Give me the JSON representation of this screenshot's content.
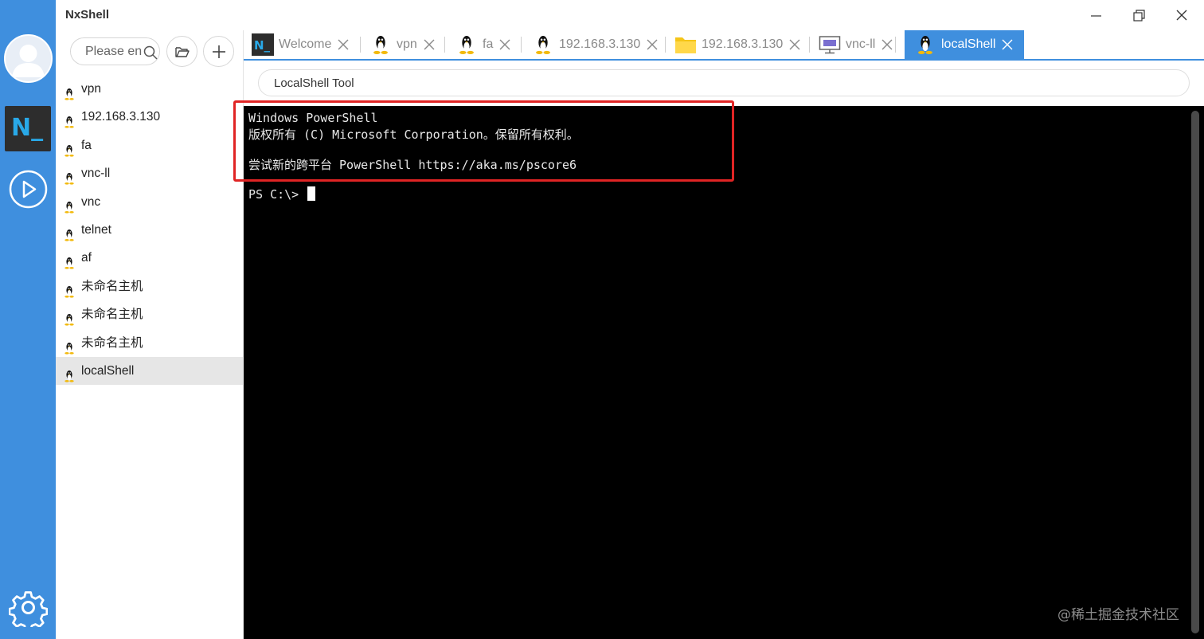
{
  "app": {
    "title": "NxShell"
  },
  "rail": {
    "logo_text": "N_"
  },
  "sidebar": {
    "search_placeholder": "Please en",
    "hosts": [
      {
        "label": "vpn"
      },
      {
        "label": "192.168.3.130"
      },
      {
        "label": "fa"
      },
      {
        "label": "vnc-ll"
      },
      {
        "label": "vnc"
      },
      {
        "label": "telnet"
      },
      {
        "label": "af"
      },
      {
        "label": "未命名主机"
      },
      {
        "label": "未命名主机"
      },
      {
        "label": "未命名主机"
      },
      {
        "label": "localShell"
      }
    ],
    "selected_index": 10
  },
  "tabs": [
    {
      "label": "Welcome",
      "icon": "nxshell-logo-icon"
    },
    {
      "label": "vpn",
      "icon": "linux-penguin-icon"
    },
    {
      "label": "fa",
      "icon": "linux-penguin-icon"
    },
    {
      "label": "192.168.3.130",
      "icon": "linux-penguin-icon"
    },
    {
      "label": "192.168.3.130",
      "icon": "folder-icon"
    },
    {
      "label": "vnc-ll",
      "icon": "monitor-icon"
    },
    {
      "label": "localShell",
      "icon": "linux-penguin-icon",
      "active": true
    }
  ],
  "toolbar": {
    "label": "LocalShell Tool"
  },
  "terminal": {
    "line1": "Windows PowerShell",
    "line2": "版权所有 (C) Microsoft Corporation。保留所有权利。",
    "line3": "尝试新的跨平台 PowerShell https://aka.ms/pscore6",
    "prompt": "PS C:\\> "
  },
  "watermark": "@稀土掘金技术社区",
  "colors": {
    "accent": "#3f8fde",
    "highlight": "#e02424",
    "terminal_bg": "#000000"
  }
}
